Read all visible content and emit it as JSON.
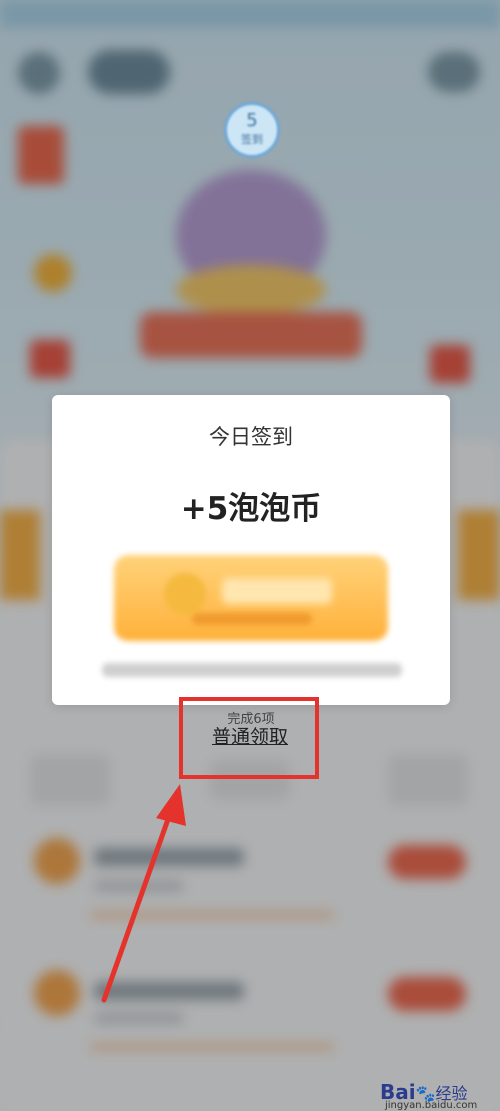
{
  "badge": {
    "number": "5",
    "label": "签到"
  },
  "modal": {
    "title": "今日签到",
    "amount": "+5泡泡币"
  },
  "done_label": "完成6项",
  "plain_claim": "普通领取",
  "watermark": {
    "brand": "Bai",
    "paw": "🐾",
    "brand_cn": "经验",
    "url": "jingyan.baidu.com"
  },
  "colors": {
    "highlight_box": "#e4332c",
    "arrow": "#e4332c",
    "primary": "#ffb13a"
  }
}
